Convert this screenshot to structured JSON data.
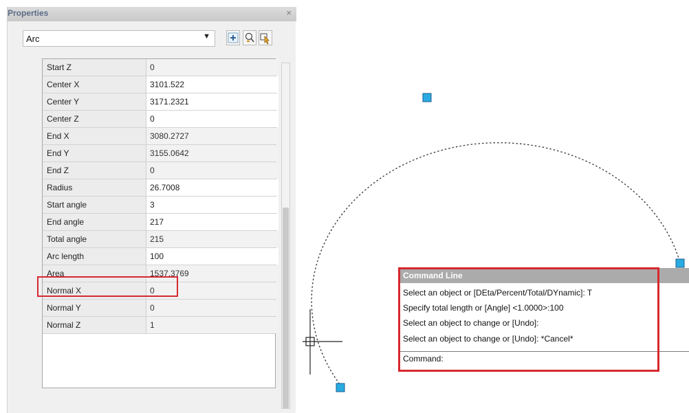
{
  "properties": {
    "title": "Properties",
    "close_glyph": "×",
    "object_type": "Arc",
    "rows": [
      {
        "name": "Start Z",
        "value": "0"
      },
      {
        "name": "Center X",
        "value": "3101.522"
      },
      {
        "name": "Center Y",
        "value": "3171.2321"
      },
      {
        "name": "Center Z",
        "value": "0"
      },
      {
        "name": "End X",
        "value": "3080.2727"
      },
      {
        "name": "End Y",
        "value": "3155.0642"
      },
      {
        "name": "End Z",
        "value": "0"
      },
      {
        "name": "Radius",
        "value": "26.7008"
      },
      {
        "name": "Start angle",
        "value": "3"
      },
      {
        "name": "End angle",
        "value": "217"
      },
      {
        "name": "Total angle",
        "value": "215"
      },
      {
        "name": "Arc length",
        "value": "100"
      },
      {
        "name": "Area",
        "value": "1537.3769"
      },
      {
        "name": "Normal X",
        "value": "0"
      },
      {
        "name": "Normal Y",
        "value": "0"
      },
      {
        "name": "Normal Z",
        "value": "1"
      }
    ],
    "toolbar_icons": [
      "toggle-pickadd-icon",
      "quick-select-icon",
      "select-objects-icon"
    ]
  },
  "command_line": {
    "title": "Command Line",
    "history": [
      "Select an object or [DEta/Percent/Total/DYnamic]: T",
      "Specify total length or [Angle] <1.0000>:100",
      "Select an object to change or [Undo]:",
      "Select an object to change or [Undo]: *Cancel*"
    ],
    "prompt": "Command:"
  },
  "colors": {
    "highlight": "#d6282e",
    "grip": "#29abe2",
    "grip_border": "#1a5f8a"
  }
}
